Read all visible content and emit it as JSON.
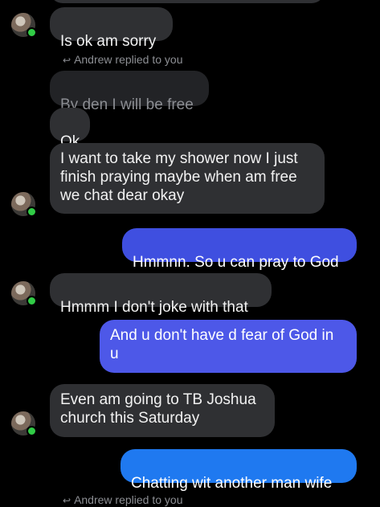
{
  "messages": [
    {
      "text": "Is ok am sorry"
    },
    {
      "reply_label": "Andrew replied to you"
    },
    {
      "text": "By den I will be free"
    },
    {
      "text": "Ok"
    },
    {
      "text": "I want to take my shower now I just finish praying maybe when am free we chat dear okay"
    },
    {
      "text": "Hmmnn. So u can pray to God"
    },
    {
      "text": "Hmmm I don't joke with that"
    },
    {
      "text": "And u don't have d fear of God in u"
    },
    {
      "text": "Even am going to TB Joshua church this Saturday"
    },
    {
      "text": "Chatting wit another man wife"
    },
    {
      "reply_label": "Andrew replied to you"
    }
  ],
  "colors": {
    "background": "#000000",
    "incoming_bubble": "#2f3033",
    "outgoing_bubble": "#3f4fe0",
    "outgoing_bubble_blue": "#1f79f0",
    "online_dot": "#31cc46"
  },
  "icons": [
    "reply-arrow-icon",
    "avatar",
    "online-status-icon"
  ]
}
